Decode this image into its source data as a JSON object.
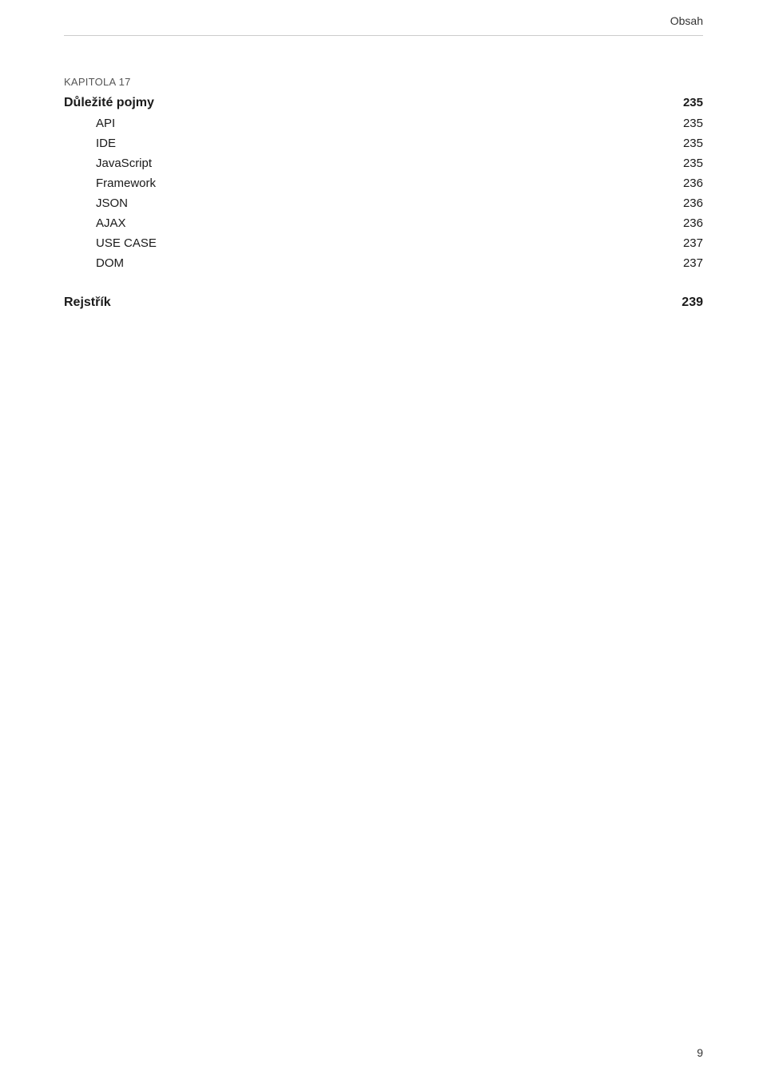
{
  "header": {
    "title": "Obsah"
  },
  "chapter": {
    "label": "KAPITOLA 17",
    "section_title": "Důležité pojmy",
    "section_page": "235",
    "items": [
      {
        "label": "API",
        "page": "235"
      },
      {
        "label": "IDE",
        "page": "235"
      },
      {
        "label": "JavaScript",
        "page": "235"
      },
      {
        "label": "Framework",
        "page": "236"
      },
      {
        "label": "JSON",
        "page": "236"
      },
      {
        "label": "AJAX",
        "page": "236"
      },
      {
        "label": "USE CASE",
        "page": "237"
      },
      {
        "label": "DOM",
        "page": "237"
      }
    ]
  },
  "rejstrik": {
    "label": "Rejstřík",
    "page": "239"
  },
  "page_number": "9"
}
